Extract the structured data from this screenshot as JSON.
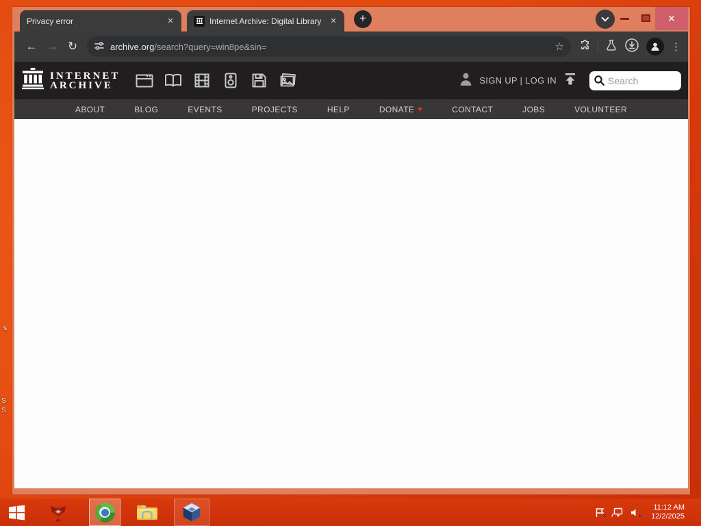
{
  "browser": {
    "tabs": [
      {
        "title": "Privacy error"
      },
      {
        "title": "Internet Archive: Digital Library"
      }
    ],
    "url_domain": "archive.org",
    "url_path": "/search?query=win8pe&sin="
  },
  "glyphs": {
    "plus": "+",
    "close": "✕",
    "back": "←",
    "forward": "→",
    "reload": "↻",
    "star": "☆",
    "kebab": "⋮",
    "heart": "♥"
  },
  "archive": {
    "wordmark_line1": "INTERNET",
    "wordmark_line2": "ARCHIVE",
    "signup_login": "SIGN UP | LOG IN",
    "search_placeholder": "Search",
    "media_types": [
      "web",
      "texts",
      "video",
      "audio",
      "software",
      "images"
    ],
    "nav_items": [
      "ABOUT",
      "BLOG",
      "EVENTS",
      "PROJECTS",
      "HELP",
      "DONATE",
      "CONTACT",
      "JOBS",
      "VOLUNTEER"
    ]
  },
  "taskbar": {
    "time": "11:12 AM",
    "date": "12/2/2025",
    "apps": [
      "start",
      "red-diamond-app",
      "chromium",
      "file-explorer",
      "virtualbox"
    ]
  },
  "desktop": {
    "icon_label_fragments": [
      "s",
      "S",
      "S"
    ]
  },
  "colors": {
    "window_frame": "#df7f5e",
    "desktop_orange": "#d63a0c",
    "taskbar_red": "#cf330b",
    "browser_chrome_dark": "#3a3a3a",
    "archive_header_dark": "#211e1f",
    "archive_nav_gray": "#393637",
    "close_button_red": "#cf5f68",
    "donate_heart": "#e03131"
  }
}
